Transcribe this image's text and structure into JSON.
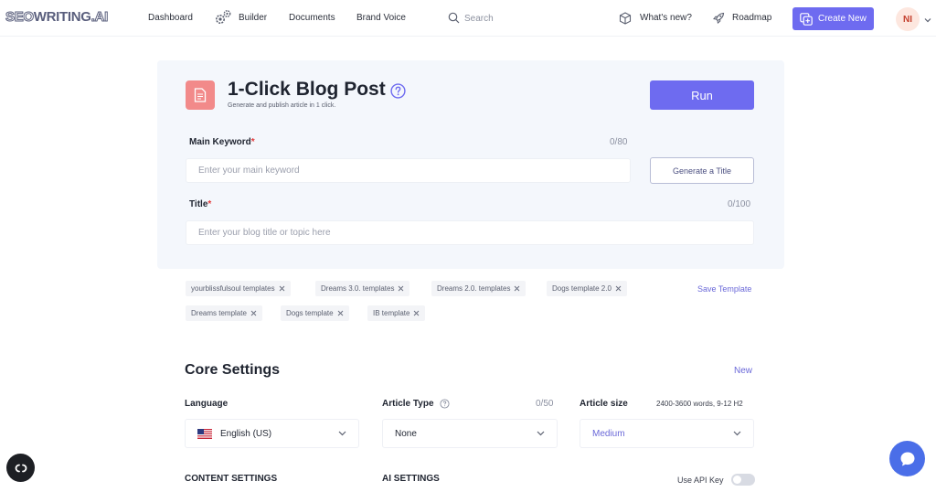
{
  "nav": {
    "logo": {
      "part1": "SEO",
      "part2": "WRITING",
      "part3": ".AI"
    },
    "dashboard": "Dashboard",
    "builder": "Builder",
    "documents": "Documents",
    "brand_voice": "Brand Voice",
    "search_placeholder": "Search",
    "whats_new": "What's new?",
    "roadmap": "Roadmap",
    "create_new": "Create New",
    "avatar_initials": "NI"
  },
  "form": {
    "title": "1-Click Blog Post",
    "subtitle": "Generate and publish article in 1 click.",
    "run_label": "Run",
    "main_keyword": {
      "label": "Main Keyword",
      "required_mark": "*",
      "counter": "0/80",
      "placeholder": "Enter your main keyword",
      "value": ""
    },
    "generate_title_label": "Generate a Title",
    "title_field": {
      "label": "Title",
      "required_mark": "*",
      "counter": "0/100",
      "placeholder": "Enter your blog title or topic here",
      "value": ""
    }
  },
  "templates": {
    "chips": [
      "yourblissfulsoul templates",
      "Dreams 3.0. templates",
      "Dreams 2.0. templates",
      "Dogs template 2.0",
      "Dreams template",
      "Dogs template",
      "IB template"
    ],
    "save_label": "Save Template"
  },
  "core_settings": {
    "title": "Core Settings",
    "new_label": "New",
    "language": {
      "label": "Language",
      "value": "English (US)"
    },
    "article_type": {
      "label": "Article Type",
      "counter": "0/50",
      "value": "None"
    },
    "article_size": {
      "label": "Article size",
      "hint": "2400-3600 words, 9-12 H2",
      "value": "Medium"
    },
    "content_settings_label": "CONTENT SETTINGS",
    "ai_settings_label": "AI SETTINGS",
    "use_api_key_label": "Use API Key",
    "use_api_key_on": false
  },
  "colors": {
    "accent": "#6e6bf0",
    "card_bg": "#f4f7fc",
    "doc_tile": "#f28a8a",
    "required": "#e23a3a",
    "chat": "#4a6ee8"
  },
  "icons": [
    "gear-icon",
    "search-icon",
    "box-icon",
    "rocket-icon",
    "plus-icon",
    "chevron-down-icon",
    "document-icon",
    "help-icon",
    "close-icon",
    "info-icon",
    "us-flag-icon",
    "chat-icon",
    "cookie-settings-icon"
  ]
}
